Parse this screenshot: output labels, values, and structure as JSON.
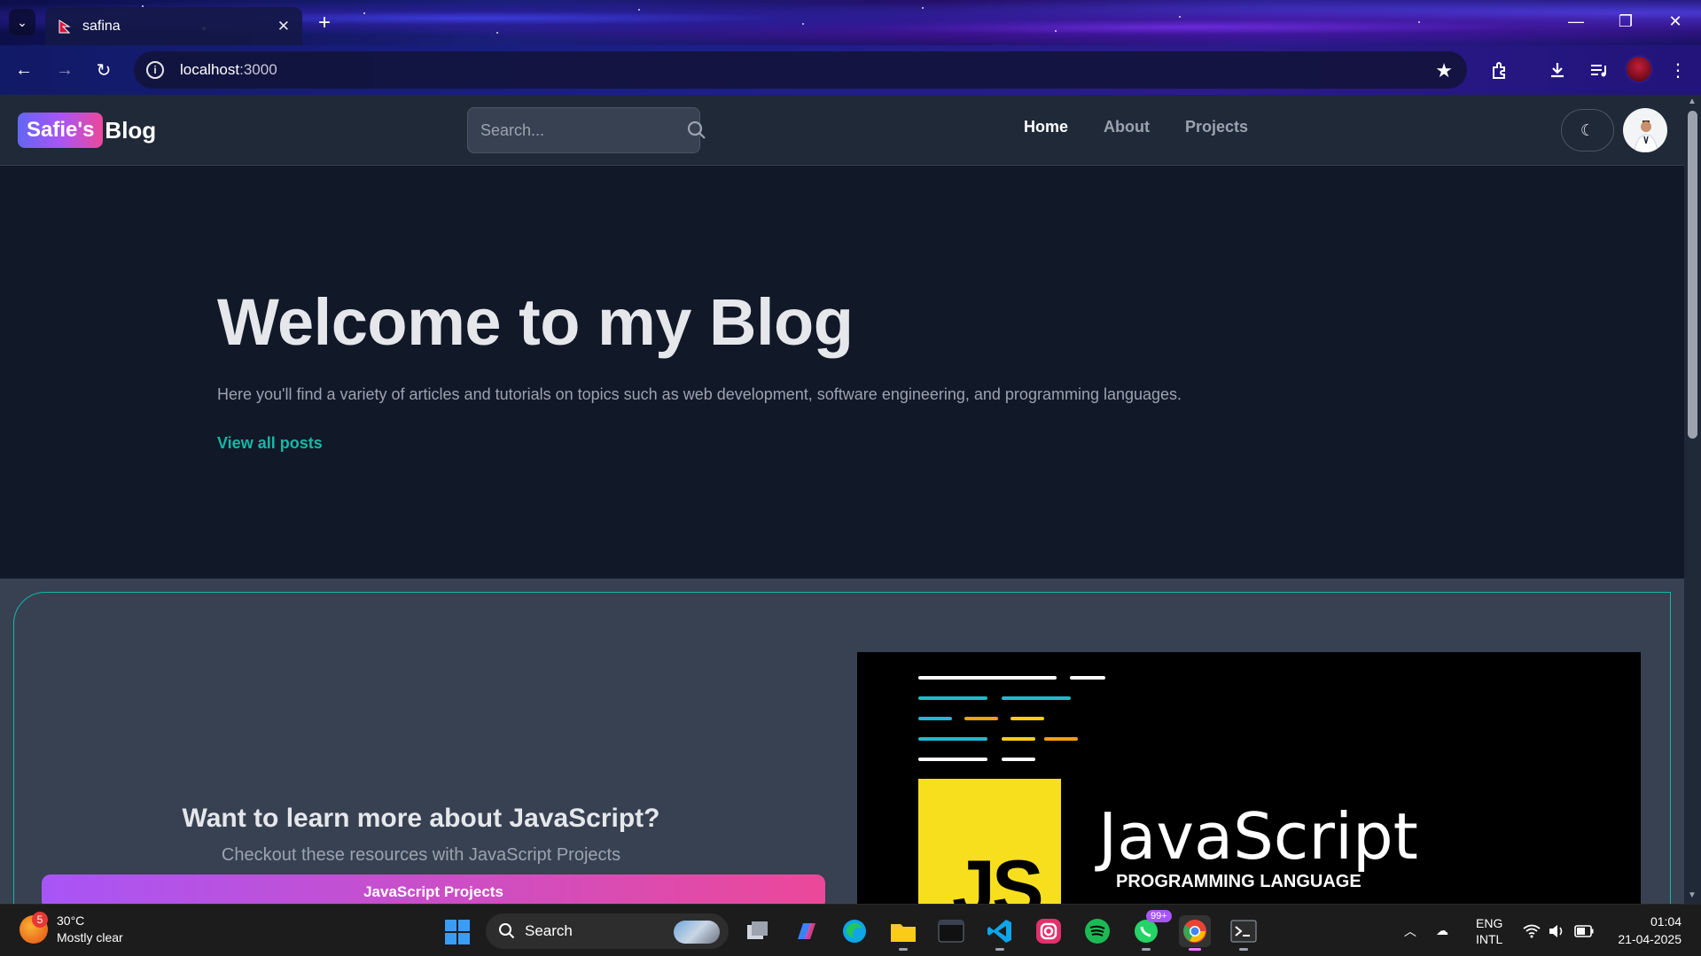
{
  "browser": {
    "tab_title": "safina",
    "url_host": "localhost",
    "url_port": ":3000"
  },
  "site": {
    "logo_badge": "Safie's",
    "logo_text": "Blog",
    "search_placeholder": "Search...",
    "nav": [
      {
        "label": "Home",
        "active": true
      },
      {
        "label": "About",
        "active": false
      },
      {
        "label": "Projects",
        "active": false
      }
    ]
  },
  "hero": {
    "title": "Welcome to my Blog",
    "subtitle": "Here you'll find a variety of articles and tutorials on topics such as web development, software engineering, and programming languages.",
    "link": "View all posts"
  },
  "cta": {
    "title": "Want to learn more about JavaScript?",
    "subtitle": "Checkout these resources with JavaScript Projects",
    "button": "JavaScript Projects",
    "image_logo": "JS",
    "image_word": "JavaScript",
    "image_caption": "PROGRAMMING LANGUAGE"
  },
  "taskbar": {
    "weather_temp": "30°C",
    "weather_desc": "Mostly clear",
    "weather_badge": "5",
    "search_label": "Search",
    "whatsapp_badge": "99+",
    "lang_top": "ENG",
    "lang_bottom": "INTL",
    "time": "01:04",
    "date": "21-04-2025"
  },
  "colors": {
    "accent_teal": "#14b8a6",
    "page_bg": "#111827",
    "header_bg": "#1f2937",
    "gradient_start": "#a855f7",
    "gradient_end": "#ec4899"
  }
}
